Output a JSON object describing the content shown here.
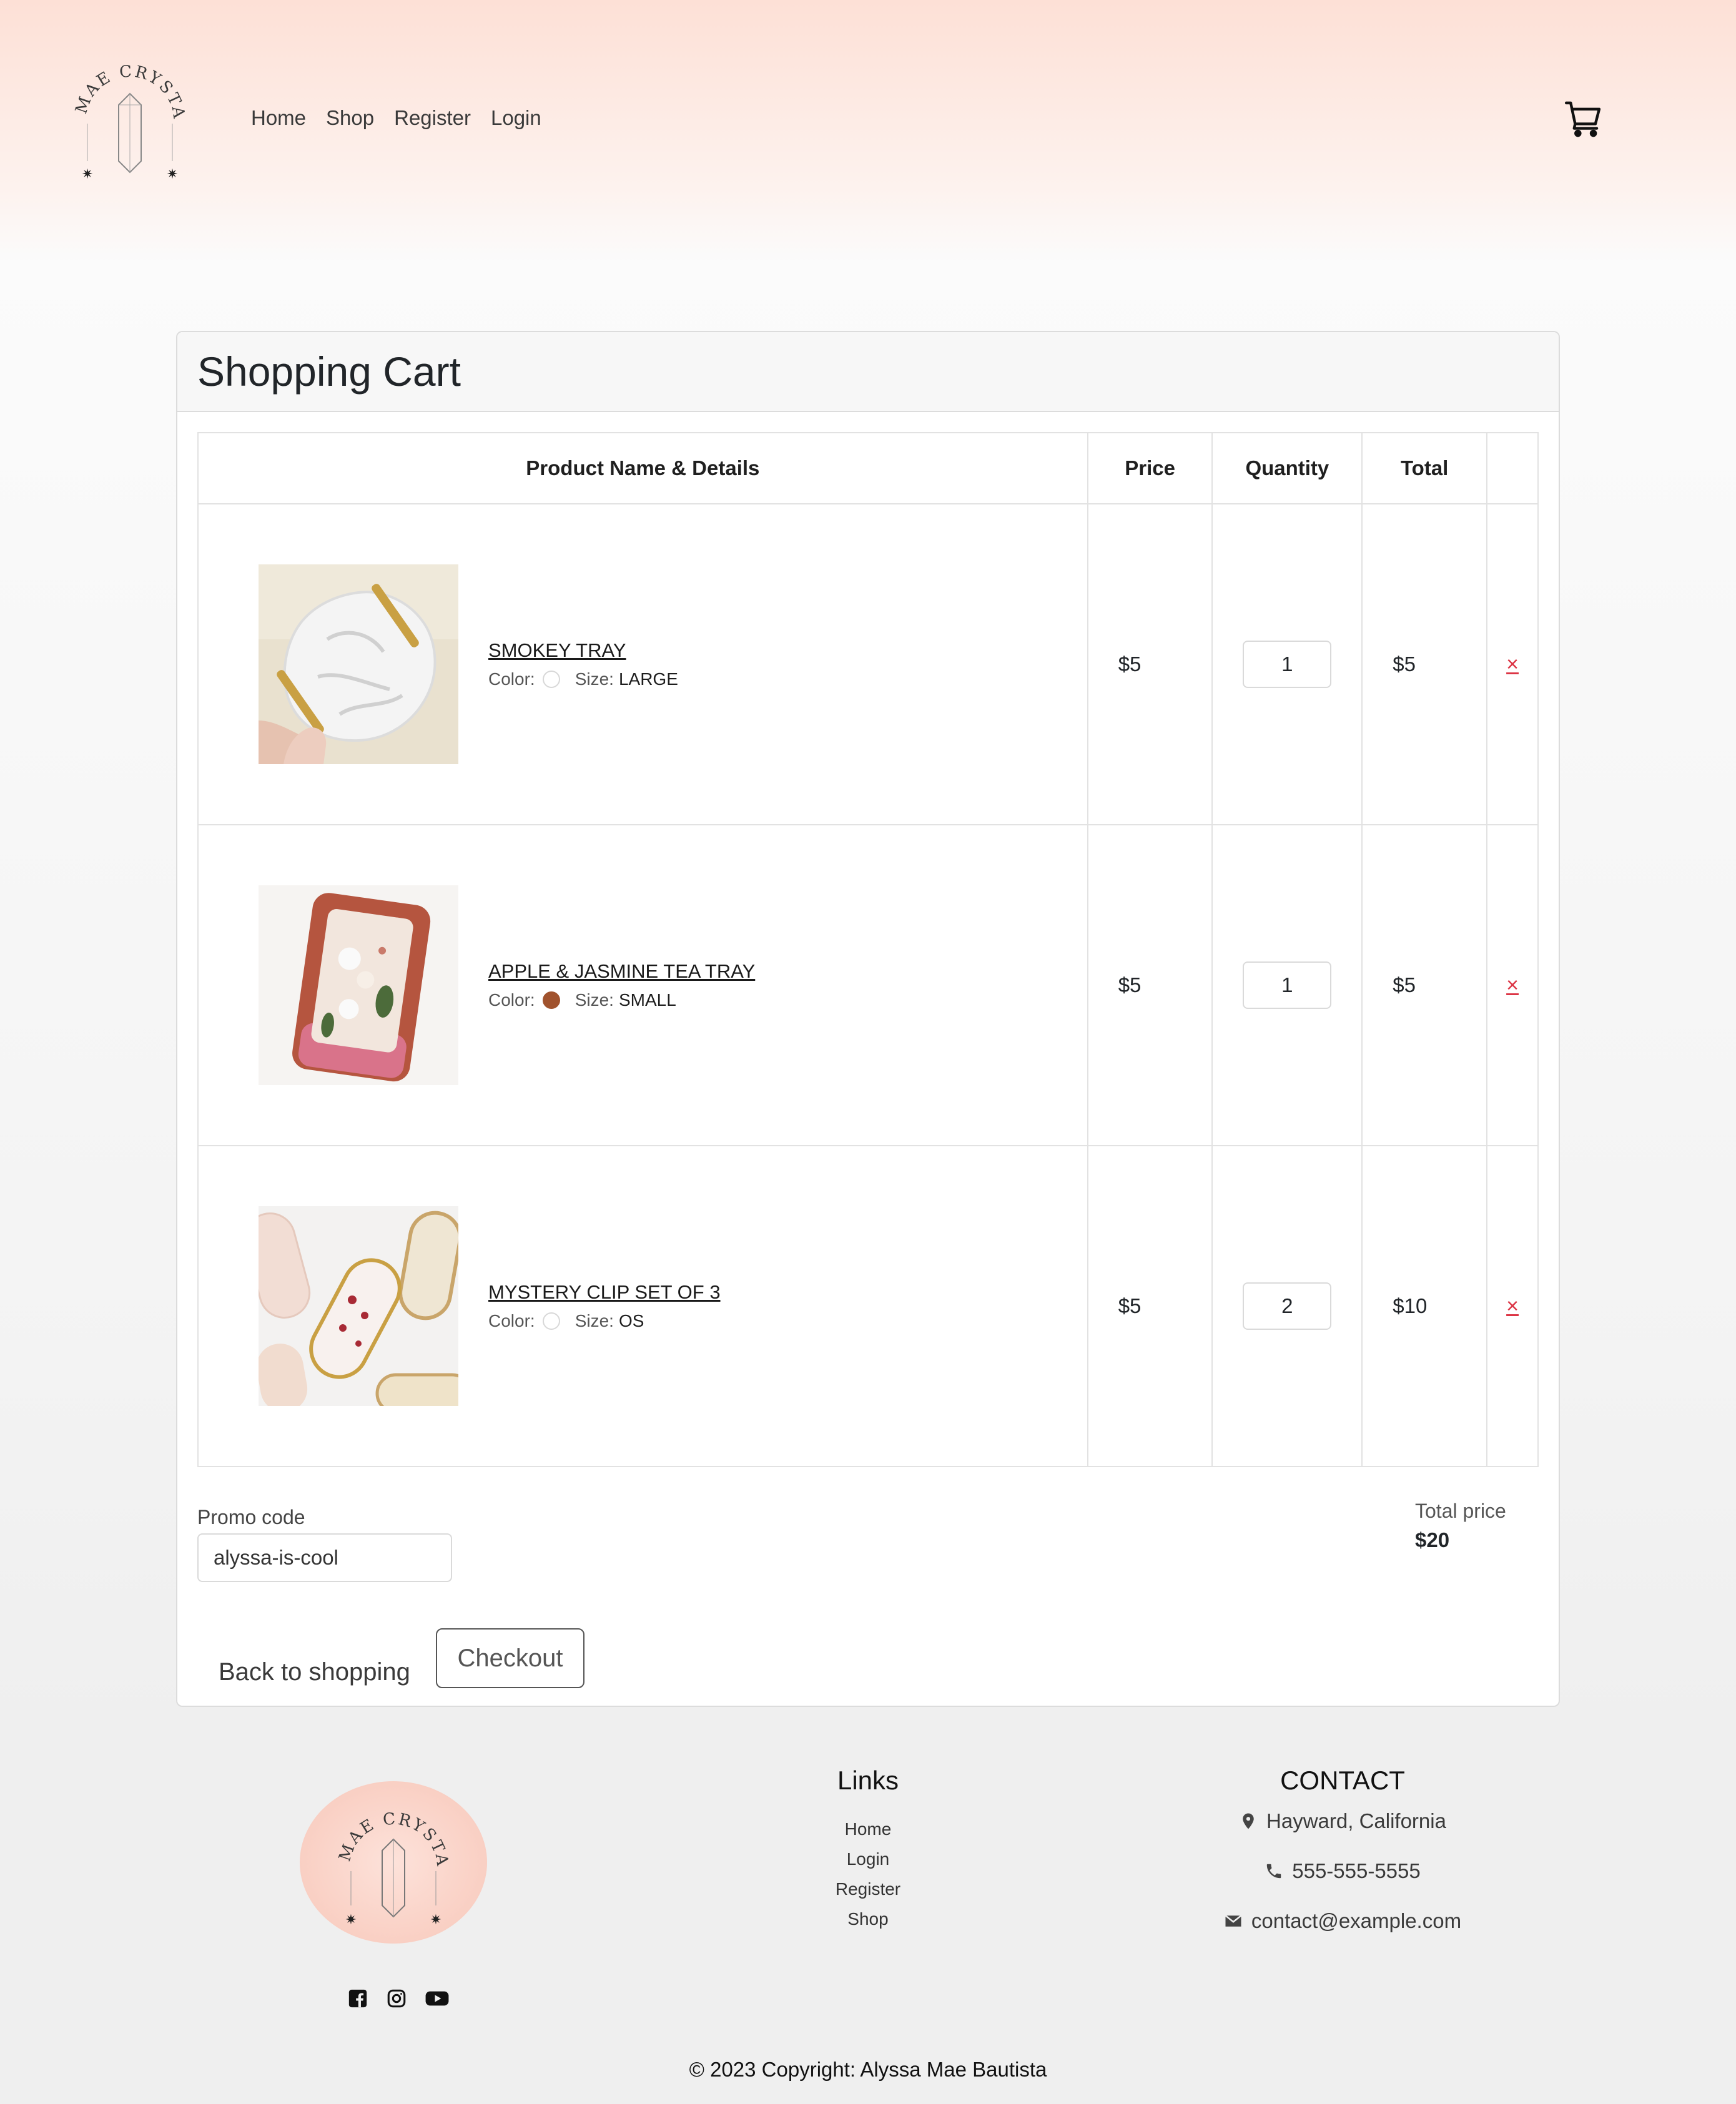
{
  "nav": {
    "logo_text": "MAE CRYSTALS",
    "items": [
      {
        "label": "Home"
      },
      {
        "label": "Shop"
      },
      {
        "label": "Register"
      },
      {
        "label": "Login"
      }
    ],
    "cart_icon": "cart-icon"
  },
  "cart": {
    "title": "Shopping Cart",
    "columns": {
      "product": "Product Name & Details",
      "price": "Price",
      "quantity": "Quantity",
      "total": "Total"
    },
    "items": [
      {
        "name": "SMOKEY TRAY",
        "color_label": "Color:",
        "color": "#ffffff",
        "size_label": "Size:",
        "size": "LARGE",
        "price": "$5",
        "quantity": "1",
        "total": "$5",
        "remove": "×"
      },
      {
        "name": "APPLE & JASMINE TEA TRAY",
        "color_label": "Color:",
        "color": "#a0522d",
        "size_label": "Size:",
        "size": "SMALL",
        "price": "$5",
        "quantity": "1",
        "total": "$5",
        "remove": "×"
      },
      {
        "name": "MYSTERY CLIP SET OF 3",
        "color_label": "Color:",
        "color": "#ffffff",
        "size_label": "Size:",
        "size": "OS",
        "price": "$5",
        "quantity": "2",
        "total": "$10",
        "remove": "×"
      }
    ],
    "promo_label": "Promo code",
    "promo_value": "alyssa-is-cool",
    "total_label": "Total price",
    "total_value": "$20",
    "back_label": "Back to shopping",
    "checkout_label": "Checkout"
  },
  "footer": {
    "logo_text": "MAE CRYSTALS",
    "socials": [
      "facebook-icon",
      "instagram-icon",
      "youtube-icon"
    ],
    "links_title": "Links",
    "links": [
      {
        "label": "Home"
      },
      {
        "label": "Login"
      },
      {
        "label": "Register"
      },
      {
        "label": "Shop"
      }
    ],
    "contact_title": "CONTACT",
    "address": "Hayward, California",
    "phone": "555-555-5555",
    "email": "contact@example.com",
    "copyright": "© 2023 Copyright: Alyssa Mae Bautista"
  },
  "colors": {
    "accent_remove": "#dc3545",
    "header_gradient_top": "#fde0d6",
    "footer_logo_bg": "#fcd3c8"
  }
}
